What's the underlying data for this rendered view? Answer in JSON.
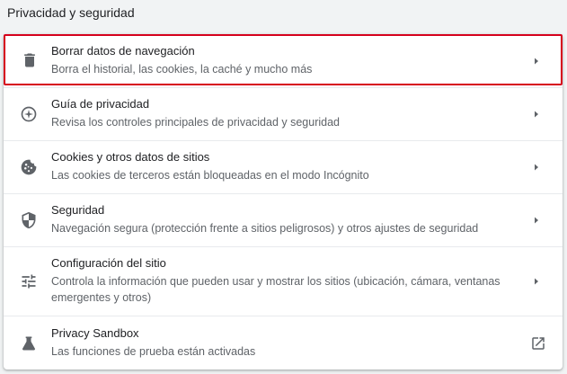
{
  "section": {
    "title": "Privacidad y seguridad"
  },
  "items": [
    {
      "label": "Borrar datos de navegación",
      "sublabel": "Borra el historial, las cookies, la caché y mucho más",
      "icon": "trash-icon",
      "action": "chevron-right-icon"
    },
    {
      "label": "Guía de privacidad",
      "sublabel": "Revisa los controles principales de privacidad y seguridad",
      "icon": "privacy-guide-icon",
      "action": "chevron-right-icon"
    },
    {
      "label": "Cookies y otros datos de sitios",
      "sublabel": "Las cookies de terceros están bloqueadas en el modo Incógnito",
      "icon": "cookie-icon",
      "action": "chevron-right-icon"
    },
    {
      "label": "Seguridad",
      "sublabel": "Navegación segura (protección frente a sitios peligrosos) y otros ajustes de seguridad",
      "icon": "shield-icon",
      "action": "chevron-right-icon"
    },
    {
      "label": "Configuración del sitio",
      "sublabel": "Controla la información que pueden usar y mostrar los sitios (ubicación, cámara, ventanas emergentes y otros)",
      "icon": "tune-icon",
      "action": "chevron-right-icon"
    },
    {
      "label": "Privacy Sandbox",
      "sublabel": "Las funciones de prueba están activadas",
      "icon": "flask-icon",
      "action": "open-in-new-icon"
    }
  ],
  "colors": {
    "highlight_border": "#d6001c",
    "icon": "#5f6368",
    "text_primary": "#202124",
    "text_secondary": "#5f6368"
  }
}
